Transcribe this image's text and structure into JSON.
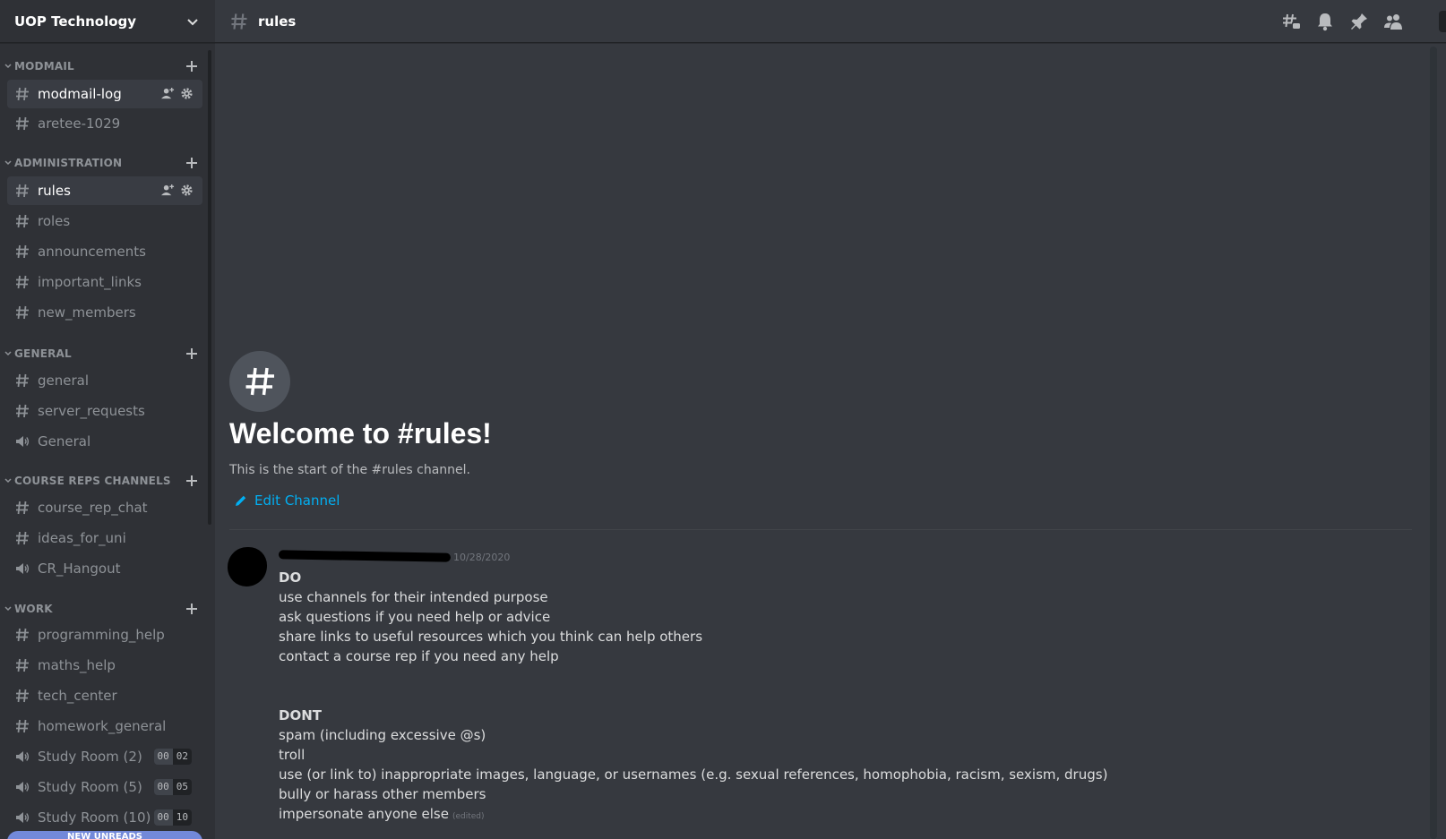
{
  "server": {
    "name": "UOP Technology"
  },
  "sidebar": {
    "categories": [
      {
        "name": "MODMAIL"
      },
      {
        "name": "ADMINISTRATION"
      },
      {
        "name": "GENERAL"
      },
      {
        "name": "COURSE REPS CHANNELS"
      },
      {
        "name": "WORK"
      }
    ],
    "channels": [
      {
        "name": "modmail-log",
        "type": "text"
      },
      {
        "name": "aretee-1029",
        "type": "text"
      },
      {
        "name": "rules",
        "type": "text"
      },
      {
        "name": "roles",
        "type": "text"
      },
      {
        "name": "announcements",
        "type": "text"
      },
      {
        "name": "important_links",
        "type": "text"
      },
      {
        "name": "new_members",
        "type": "text"
      },
      {
        "name": "general",
        "type": "text"
      },
      {
        "name": "server_requests",
        "type": "text"
      },
      {
        "name": "General",
        "type": "voice"
      },
      {
        "name": "course_rep_chat",
        "type": "text"
      },
      {
        "name": "ideas_for_uni",
        "type": "text"
      },
      {
        "name": "CR_Hangout",
        "type": "voice"
      },
      {
        "name": "programming_help",
        "type": "text"
      },
      {
        "name": "maths_help",
        "type": "text"
      },
      {
        "name": "tech_center",
        "type": "text"
      },
      {
        "name": "homework_general",
        "type": "text"
      },
      {
        "name": "Study Room (2)",
        "type": "voice",
        "count_left": "00",
        "count_right": "02"
      },
      {
        "name": "Study Room (5)",
        "type": "voice",
        "count_left": "00",
        "count_right": "05"
      },
      {
        "name": "Study Room (10)",
        "type": "voice",
        "count_left": "00",
        "count_right": "10"
      }
    ],
    "new_unreads": "NEW UNREADS"
  },
  "topbar": {
    "channel_name": "rules"
  },
  "welcome": {
    "title": "Welcome to #rules!",
    "subtitle": "This is the start of the #rules channel.",
    "edit_label": "Edit Channel"
  },
  "message": {
    "timestamp": "10/28/2020",
    "do_heading": "DO",
    "do_items": [
      "use channels for their intended purpose",
      "ask questions if you need help or advice",
      "share links to useful resources which you think can help others",
      "contact a course rep if you need any help"
    ],
    "dont_heading": "DONT",
    "dont_items": [
      "spam (including excessive @s)",
      "troll",
      "use (or link to) inappropriate images, language, or usernames (e.g. sexual references, homophobia, racism, sexism, drugs)",
      "bully or harass other members",
      "impersonate anyone else"
    ],
    "edited_label": "(edited)"
  },
  "colors": {
    "background": "#36393f",
    "sidebar": "#2f3136",
    "link": "#00b0f4",
    "unreads": "#7289da"
  },
  "icons": {
    "server_menu": "chevron-down-icon",
    "text_channel": "hash-icon",
    "voice_channel": "speaker-icon",
    "category_add": "plus-icon",
    "invite": "add-member-icon",
    "settings": "gear-icon",
    "threads": "threads-icon",
    "notifications": "bell-icon",
    "pins": "pin-icon",
    "members": "members-icon",
    "edit": "pencil-icon"
  }
}
